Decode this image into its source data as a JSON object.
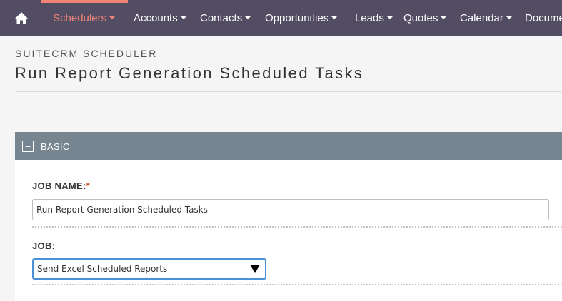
{
  "nav": {
    "items": [
      {
        "label": "Schedulers",
        "active": true
      },
      {
        "label": "Accounts"
      },
      {
        "label": "Contacts"
      },
      {
        "label": "Opportunities"
      },
      {
        "label": "Leads"
      },
      {
        "label": "Quotes"
      },
      {
        "label": "Calendar"
      },
      {
        "label": "Documents"
      }
    ]
  },
  "header": {
    "module": "SUITECRM SCHEDULER",
    "title": "Run Report Generation Scheduled Tasks"
  },
  "panel": {
    "collapse_symbol": "−",
    "title": "BASIC",
    "fields": {
      "job_name": {
        "label": "JOB NAME:",
        "required_mark": "*",
        "value": "Run Report Generation Scheduled Tasks"
      },
      "job": {
        "label": "JOB:",
        "value": "Send Excel Scheduled Reports"
      }
    }
  },
  "colors": {
    "nav_bg": "#534d64",
    "accent": "#f08377",
    "panel_header": "#778591",
    "focus": "#4d8fd6"
  },
  "icons": {
    "home": "home-icon",
    "caret": "caret-down-icon",
    "collapse": "collapse-minus-icon",
    "select_arrow": "triangle-down-icon"
  }
}
